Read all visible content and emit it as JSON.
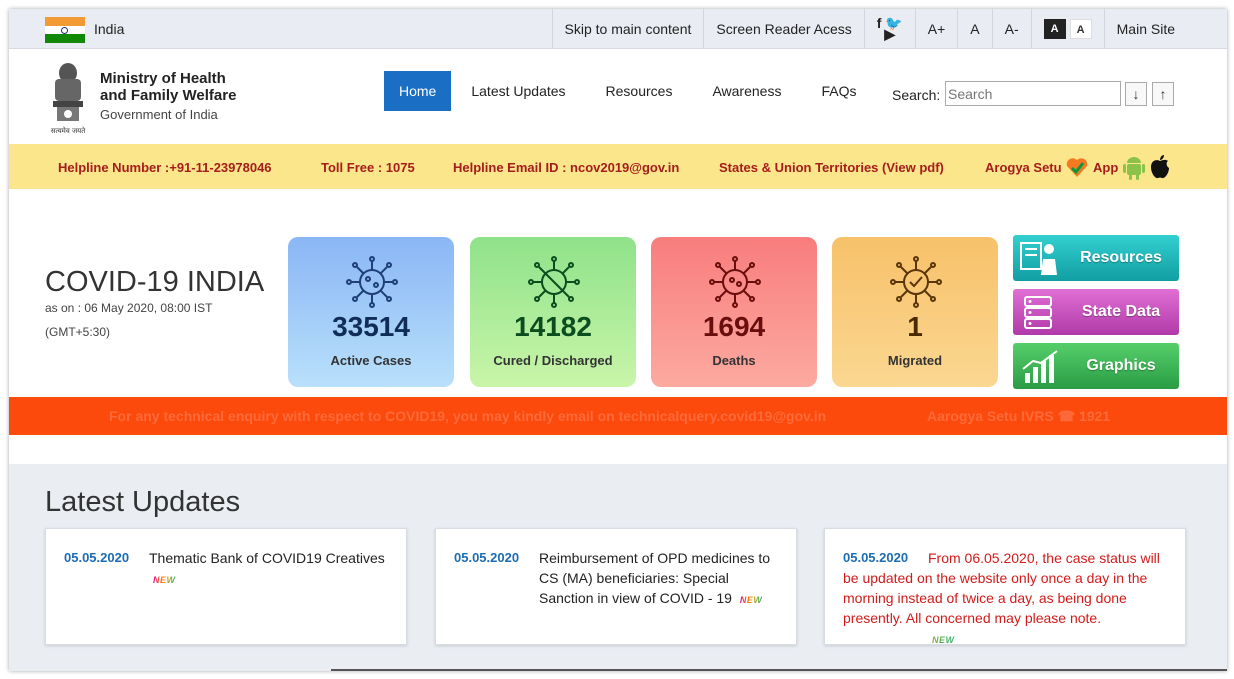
{
  "topbar": {
    "country": "India",
    "skip_link": "Skip to main content",
    "screen_reader": "Screen Reader Acess",
    "font_increase": "A+",
    "font_normal": "A",
    "font_decrease": "A-",
    "contrast_dark": "A",
    "contrast_light": "A",
    "main_site": "Main Site"
  },
  "header": {
    "ministry_line1": "Ministry of Health",
    "ministry_line2": "and Family Welfare",
    "government": "Government of India",
    "emblem_motto": "सत्यमेव जयते"
  },
  "nav": {
    "items": [
      "Home",
      "Latest Updates",
      "Resources",
      "Awareness",
      "FAQs"
    ],
    "active": "Home"
  },
  "search": {
    "label": "Search:",
    "placeholder": "Search",
    "down_arrow": "↓",
    "up_arrow": "↑"
  },
  "helpline": {
    "number": "Helpline Number :+91-11-23978046",
    "toll_free": "Toll Free : 1075",
    "email": "Helpline Email ID : ncov2019@gov.in",
    "states": "States & Union Territories (View pdf)",
    "arogya_left": "Arogya Setu",
    "arogya_right": "App"
  },
  "covid": {
    "title": "COVID-19 INDIA",
    "as_on": "as on : 06 May 2020, 08:00 IST",
    "gmt": "(GMT+5:30)"
  },
  "stats": [
    {
      "value": "33514",
      "label": "Active Cases",
      "color": "#0f2d57",
      "icon": "virus-icon"
    },
    {
      "value": "14182",
      "label": "Cured / Discharged",
      "color": "#0b4d1e",
      "icon": "virus-cured-icon"
    },
    {
      "value": "1694",
      "label": "Deaths",
      "color": "#6a0d0d",
      "icon": "virus-death-icon"
    },
    {
      "value": "1",
      "label": "Migrated",
      "color": "#4a2a05",
      "icon": "virus-migrated-icon"
    }
  ],
  "side_buttons": {
    "resources": "Resources",
    "state_data": "State Data",
    "graphics": "Graphics"
  },
  "ticker": {
    "text1": "For any technical enquiry with respect to COVID19, you may kindly email on technicalquery.covid19@gov.in",
    "text2": "Aarogya Setu IVRS ☎ 1921"
  },
  "updates": {
    "title": "Latest Updates",
    "new_badge": "NEW",
    "items": [
      {
        "date": "05.05.2020",
        "text": "Thematic Bank of COVID19 Creatives"
      },
      {
        "date": "05.05.2020",
        "text": "Reimbursement of OPD medicines to CS (MA) beneficiaries: Special Sanction in view of COVID - 19"
      },
      {
        "date": "05.05.2020",
        "text": "From 06.05.2020, the case status will be updated on the website only once a day in the morning instead of twice a day, as being done presently. All concerned may please note."
      }
    ]
  },
  "colors": {
    "topbar": "#e9ecf2",
    "nav_active": "#1a6fc4",
    "helpline_bg": "#fbe68b",
    "helpline_text": "#a51d1d",
    "ticker_bg": "#fc4a0c",
    "date_blue": "#1c6cb4",
    "alert_red": "#d21b1b"
  }
}
